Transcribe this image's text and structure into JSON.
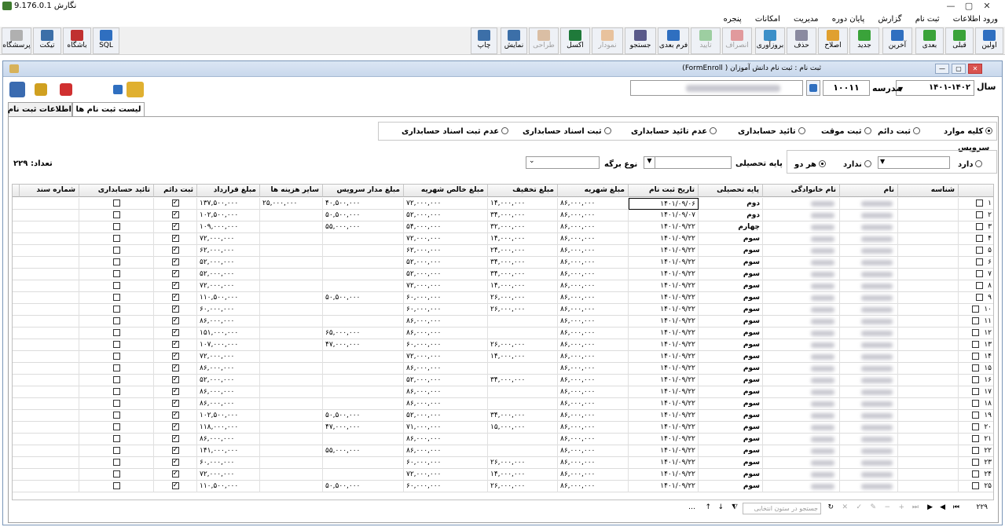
{
  "app": {
    "title": "نگارش 9.176.0.1",
    "win_buttons": [
      "—",
      "▢",
      "✕"
    ]
  },
  "menu": [
    "ورود اطلاعات",
    "ثبت نام",
    "گزارش",
    "پایان دوره",
    "مدیریت",
    "امکانات",
    "پنجره"
  ],
  "toolbar": {
    "right": [
      "اولین",
      "قبلی",
      "بعدی",
      "آخرین",
      "جدید",
      "اصلاح",
      "حذف",
      "بروزآوری",
      "انصراف",
      "تایید",
      "فرم بعدی",
      "جستجو",
      "نمودار",
      "اکسل",
      "طراحی",
      "نمایش",
      "چاپ"
    ],
    "left": [
      "پرسشگاه",
      "تیکت",
      "باشگاه",
      "SQL"
    ]
  },
  "form": {
    "title": "ثبت نام : ثبت نام دانش آموزان ( FormEnroll)",
    "year_label": "سال",
    "year_value": "۱۴۰۱-۱۴۰۲",
    "school_label": "مدرسه",
    "school_code": "۱۰۰۱۱"
  },
  "tabs": [
    "اطلاعات ثبت نام",
    "لیست ثبت نام ها"
  ],
  "filters": {
    "radios": [
      "کلیه موارد",
      "ثبت دائم",
      "ثبت موقت",
      "تائید حسابداری",
      "عدم تائید حسابداری",
      "ثبت اسناد حسابداری",
      "عدم ثبت اسناد حسابداری"
    ],
    "service_label": "سرویس",
    "service_opts": [
      "دارد",
      "ندارد",
      "هر دو"
    ],
    "grade_label": "پایه تحصیلی",
    "sheet_label": "نوع برگه",
    "count_label": "تعداد:",
    "count_value": "۲۲۹"
  },
  "columns": [
    "شناسه",
    "نام",
    "نام خانوادگی",
    "پایه تحصیلی",
    "تاریخ ثبت نام",
    "مبلغ شهریه",
    "مبلغ تخفیف",
    "مبلغ خالص شهریه",
    "مبلغ مدار سرویس",
    "سایر هزینه ها",
    "مبلغ قرارداد",
    "ثبت دائم",
    "تائید حسابداری",
    "شماره سند"
  ],
  "rows": [
    [
      "۱",
      "دوم",
      "۱۴۰۱/۰۹/۰۶",
      "۸۶,۰۰۰,۰۰۰",
      "۱۴,۰۰۰,۰۰۰",
      "۷۲,۰۰۰,۰۰۰",
      "۴۰,۵۰۰,۰۰۰",
      "۲۵,۰۰۰,۰۰۰",
      "۱۳۷,۵۰۰,۰۰۰"
    ],
    [
      "۲",
      "دوم",
      "۱۴۰۱/۰۹/۰۷",
      "۸۶,۰۰۰,۰۰۰",
      "۳۴,۰۰۰,۰۰۰",
      "۵۲,۰۰۰,۰۰۰",
      "۵۰,۵۰۰,۰۰۰",
      "",
      "۱۰۲,۵۰۰,۰۰۰"
    ],
    [
      "۳",
      "چهارم",
      "۱۴۰۱/۰۹/۲۲",
      "۸۶,۰۰۰,۰۰۰",
      "۳۲,۰۰۰,۰۰۰",
      "۵۴,۰۰۰,۰۰۰",
      "۵۵,۰۰۰,۰۰۰",
      "",
      "۱۰۹,۰۰۰,۰۰۰"
    ],
    [
      "۴",
      "سوم",
      "۱۴۰۱/۰۹/۲۲",
      "۸۶,۰۰۰,۰۰۰",
      "۱۴,۰۰۰,۰۰۰",
      "۷۲,۰۰۰,۰۰۰",
      "",
      "",
      "۷۲,۰۰۰,۰۰۰"
    ],
    [
      "۵",
      "سوم",
      "۱۴۰۱/۰۹/۲۲",
      "۸۶,۰۰۰,۰۰۰",
      "۲۴,۰۰۰,۰۰۰",
      "۶۲,۰۰۰,۰۰۰",
      "",
      "",
      "۶۲,۰۰۰,۰۰۰"
    ],
    [
      "۶",
      "سوم",
      "۱۴۰۱/۰۹/۲۲",
      "۸۶,۰۰۰,۰۰۰",
      "۳۴,۰۰۰,۰۰۰",
      "۵۲,۰۰۰,۰۰۰",
      "",
      "",
      "۵۲,۰۰۰,۰۰۰"
    ],
    [
      "۷",
      "سوم",
      "۱۴۰۱/۰۹/۲۲",
      "۸۶,۰۰۰,۰۰۰",
      "۳۴,۰۰۰,۰۰۰",
      "۵۲,۰۰۰,۰۰۰",
      "",
      "",
      "۵۲,۰۰۰,۰۰۰"
    ],
    [
      "۸",
      "سوم",
      "۱۴۰۱/۰۹/۲۲",
      "۸۶,۰۰۰,۰۰۰",
      "۱۴,۰۰۰,۰۰۰",
      "۷۲,۰۰۰,۰۰۰",
      "",
      "",
      "۷۲,۰۰۰,۰۰۰"
    ],
    [
      "۹",
      "سوم",
      "۱۴۰۱/۰۹/۲۲",
      "۸۶,۰۰۰,۰۰۰",
      "۲۶,۰۰۰,۰۰۰",
      "۶۰,۰۰۰,۰۰۰",
      "۵۰,۵۰۰,۰۰۰",
      "",
      "۱۱۰,۵۰۰,۰۰۰"
    ],
    [
      "۱۰",
      "سوم",
      "۱۴۰۱/۰۹/۲۲",
      "۸۶,۰۰۰,۰۰۰",
      "۲۶,۰۰۰,۰۰۰",
      "۶۰,۰۰۰,۰۰۰",
      "",
      "",
      "۶۰,۰۰۰,۰۰۰"
    ],
    [
      "۱۱",
      "سوم",
      "۱۴۰۱/۰۹/۲۲",
      "۸۶,۰۰۰,۰۰۰",
      "",
      "۸۶,۰۰۰,۰۰۰",
      "",
      "",
      "۸۶,۰۰۰,۰۰۰"
    ],
    [
      "۱۲",
      "سوم",
      "۱۴۰۱/۰۹/۲۲",
      "۸۶,۰۰۰,۰۰۰",
      "",
      "۸۶,۰۰۰,۰۰۰",
      "۶۵,۰۰۰,۰۰۰",
      "",
      "۱۵۱,۰۰۰,۰۰۰"
    ],
    [
      "۱۳",
      "سوم",
      "۱۴۰۱/۰۹/۲۲",
      "۸۶,۰۰۰,۰۰۰",
      "۲۶,۰۰۰,۰۰۰",
      "۶۰,۰۰۰,۰۰۰",
      "۴۷,۰۰۰,۰۰۰",
      "",
      "۱۰۷,۰۰۰,۰۰۰"
    ],
    [
      "۱۴",
      "سوم",
      "۱۴۰۱/۰۹/۲۲",
      "۸۶,۰۰۰,۰۰۰",
      "۱۴,۰۰۰,۰۰۰",
      "۷۲,۰۰۰,۰۰۰",
      "",
      "",
      "۷۲,۰۰۰,۰۰۰"
    ],
    [
      "۱۵",
      "سوم",
      "۱۴۰۱/۰۹/۲۲",
      "۸۶,۰۰۰,۰۰۰",
      "",
      "۸۶,۰۰۰,۰۰۰",
      "",
      "",
      "۸۶,۰۰۰,۰۰۰"
    ],
    [
      "۱۶",
      "سوم",
      "۱۴۰۱/۰۹/۲۲",
      "۸۶,۰۰۰,۰۰۰",
      "۳۴,۰۰۰,۰۰۰",
      "۵۲,۰۰۰,۰۰۰",
      "",
      "",
      "۵۲,۰۰۰,۰۰۰"
    ],
    [
      "۱۷",
      "سوم",
      "۱۴۰۱/۰۹/۲۲",
      "۸۶,۰۰۰,۰۰۰",
      "",
      "۸۶,۰۰۰,۰۰۰",
      "",
      "",
      "۸۶,۰۰۰,۰۰۰"
    ],
    [
      "۱۸",
      "سوم",
      "۱۴۰۱/۰۹/۲۲",
      "۸۶,۰۰۰,۰۰۰",
      "",
      "۸۶,۰۰۰,۰۰۰",
      "",
      "",
      "۸۶,۰۰۰,۰۰۰"
    ],
    [
      "۱۹",
      "سوم",
      "۱۴۰۱/۰۹/۲۲",
      "۸۶,۰۰۰,۰۰۰",
      "۳۴,۰۰۰,۰۰۰",
      "۵۲,۰۰۰,۰۰۰",
      "۵۰,۵۰۰,۰۰۰",
      "",
      "۱۰۲,۵۰۰,۰۰۰"
    ],
    [
      "۲۰",
      "سوم",
      "۱۴۰۱/۰۹/۲۲",
      "۸۶,۰۰۰,۰۰۰",
      "۱۵,۰۰۰,۰۰۰",
      "۷۱,۰۰۰,۰۰۰",
      "۴۷,۰۰۰,۰۰۰",
      "",
      "۱۱۸,۰۰۰,۰۰۰"
    ],
    [
      "۲۱",
      "سوم",
      "۱۴۰۱/۰۹/۲۲",
      "۸۶,۰۰۰,۰۰۰",
      "",
      "۸۶,۰۰۰,۰۰۰",
      "",
      "",
      "۸۶,۰۰۰,۰۰۰"
    ],
    [
      "۲۲",
      "سوم",
      "۱۴۰۱/۰۹/۲۲",
      "۸۶,۰۰۰,۰۰۰",
      "",
      "۸۶,۰۰۰,۰۰۰",
      "۵۵,۰۰۰,۰۰۰",
      "",
      "۱۴۱,۰۰۰,۰۰۰"
    ],
    [
      "۲۳",
      "سوم",
      "۱۴۰۱/۰۹/۲۲",
      "۸۶,۰۰۰,۰۰۰",
      "۲۶,۰۰۰,۰۰۰",
      "۶۰,۰۰۰,۰۰۰",
      "",
      "",
      "۶۰,۰۰۰,۰۰۰"
    ],
    [
      "۲۴",
      "سوم",
      "۱۴۰۱/۰۹/۲۲",
      "۸۶,۰۰۰,۰۰۰",
      "۱۴,۰۰۰,۰۰۰",
      "۷۲,۰۰۰,۰۰۰",
      "",
      "",
      "۷۲,۰۰۰,۰۰۰"
    ],
    [
      "۲۵",
      "سوم",
      "۱۴۰۱/۰۹/۲۲",
      "۸۶,۰۰۰,۰۰۰",
      "۲۶,۰۰۰,۰۰۰",
      "۶۰,۰۰۰,۰۰۰",
      "۵۰,۵۰۰,۰۰۰",
      "",
      "۱۱۰,۵۰۰,۰۰۰"
    ]
  ],
  "nav": {
    "count": "۲۲۹",
    "search_placeholder": "جستجو در ستون انتخابی"
  }
}
